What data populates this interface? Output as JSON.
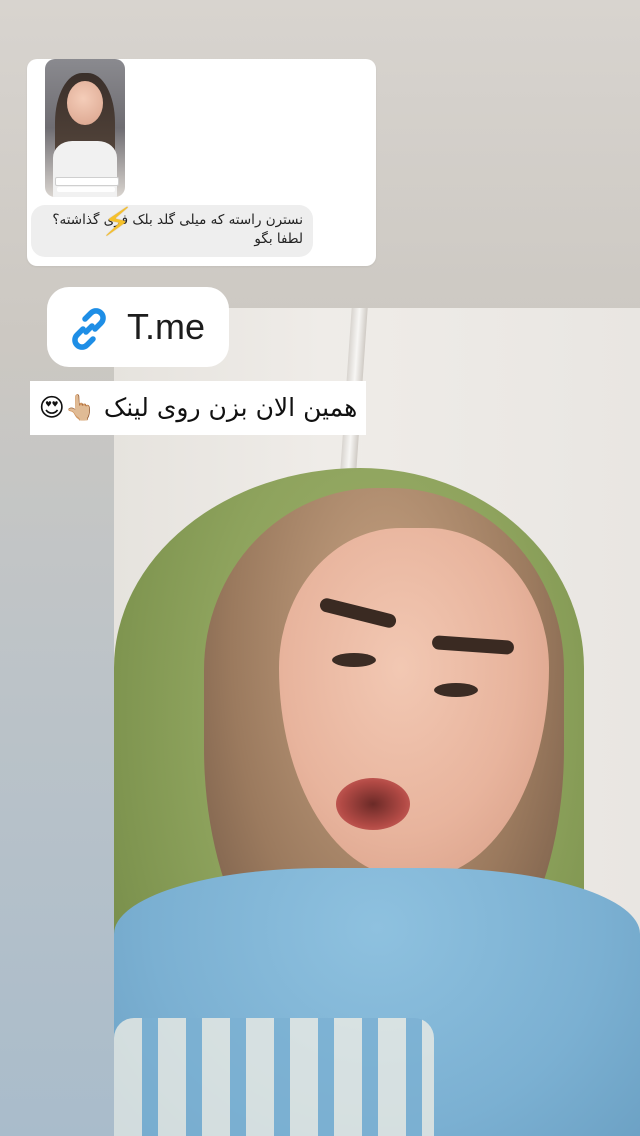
{
  "story": {
    "question_sticker": {
      "text_line1": "نسترن راسته که میلی گلد بلک فری گذاشته؟",
      "text_line2": "لطفا بگو",
      "emoji": "⚡",
      "thumbnail_icon": "reel-thumbnail"
    },
    "link_sticker": {
      "label": "T.me",
      "icon": "link-icon",
      "icon_color": "#1e8ee6"
    },
    "cta_caption": {
      "text": "همین الان بزن روی لینک 👆🏼😍"
    }
  },
  "colors": {
    "scarf": "#8ea35d",
    "shirt": "#7bb0d2",
    "background_top": "#d8d4cf",
    "background_bottom": "#a9bccb"
  }
}
